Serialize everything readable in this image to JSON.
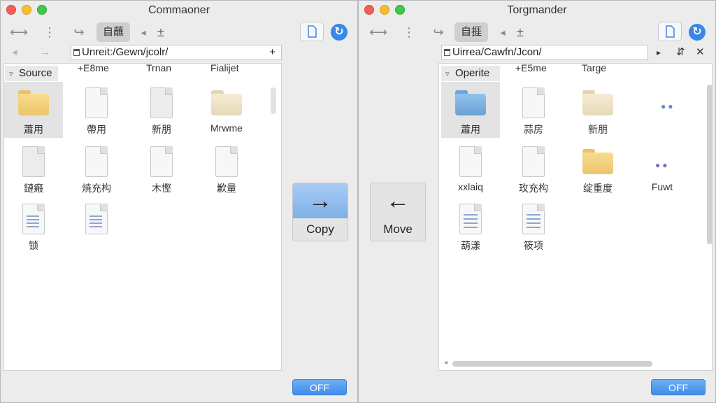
{
  "left": {
    "title": "Commaoner",
    "toolbar": {
      "back": "⟷",
      "split": "⋮",
      "forward": "↪",
      "segment": "自蘸",
      "prev": "◂",
      "up": "±",
      "sync": "↻"
    },
    "nav": {
      "back": "◂",
      "forward": "→",
      "add": "+"
    },
    "path": "Unreit:/Gewn/jcolr/",
    "sidebar": {
      "header": "Source"
    },
    "columns": [
      "+E8me",
      "Trnan",
      "Fialijet"
    ],
    "items": [
      {
        "label": "蕭用",
        "kind": "folder",
        "color": "yellow",
        "selected": true
      },
      {
        "label": "帶用",
        "kind": "doc"
      },
      {
        "label": "新朋",
        "kind": "doc"
      },
      {
        "label": "Mrwme",
        "kind": "folder",
        "color": "beige"
      },
      {
        "label": "鏈瘢",
        "kind": "doc"
      },
      {
        "label": "焼充构",
        "kind": "doc"
      },
      {
        "label": "木慳",
        "kind": "doc"
      },
      {
        "label": "歉量",
        "kind": "doc"
      },
      {
        "label": "锁",
        "kind": "doc-lines"
      },
      {
        "label": "",
        "kind": "doc-lines"
      }
    ],
    "off_label": "OFF"
  },
  "actions": {
    "copy": {
      "icon": "→",
      "label": "Copy"
    },
    "move": {
      "icon": "←",
      "label": "Move"
    }
  },
  "right": {
    "title": "Torgmander",
    "toolbar": {
      "back": "⟷",
      "split": "⋮",
      "forward": "↪",
      "segment": "自捱",
      "prev": "◂",
      "up": "±",
      "sync": "↻"
    },
    "nav": {
      "arrow": "▸",
      "sort": "⇵",
      "close": "✕"
    },
    "path": "Uirrea/Cawfn/Jcon/",
    "sidebar": {
      "header": "Operite"
    },
    "columns": [
      "+E5me",
      "Targe"
    ],
    "items": [
      {
        "label": "蕭用",
        "kind": "folder",
        "color": "blue",
        "selected": true
      },
      {
        "label": "蒜房",
        "kind": "doc"
      },
      {
        "label": "新朋",
        "kind": "folder",
        "color": "beige"
      },
      {
        "label": "",
        "kind": "dots"
      },
      {
        "label": "xxlaiq",
        "kind": "doc"
      },
      {
        "label": "玫充构",
        "kind": "doc"
      },
      {
        "label": "绽重度",
        "kind": "folder",
        "color": "yellow"
      },
      {
        "label": "Fuwt",
        "kind": "dots"
      },
      {
        "label": "葫漾",
        "kind": "doc-lines"
      },
      {
        "label": "筱项",
        "kind": "doc-lines"
      }
    ],
    "off_label": "OFF"
  }
}
